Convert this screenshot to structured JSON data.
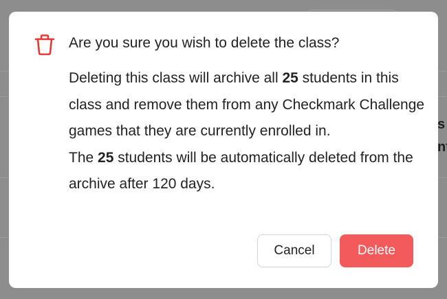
{
  "dialog": {
    "title": "Are you sure you wish to delete the class?",
    "body_line1_pre": "Deleting this class will archive all ",
    "student_count": "25",
    "body_line1_post": " students in this class and remove them from any Checkmark Challenge games that they are currently enrolled in.",
    "body_line2_pre": "The ",
    "body_line2_post": " students will be automatically deleted from the archive after 120 days.",
    "cancel_label": "Cancel",
    "delete_label": "Delete",
    "icon": "trash-icon"
  },
  "background": {
    "partial_text_1": "s p",
    "partial_text_2": "nt"
  },
  "colors": {
    "delete_button": "#f25a5b",
    "trash_icon": "#e53935",
    "overlay": "#8d8d8d"
  }
}
